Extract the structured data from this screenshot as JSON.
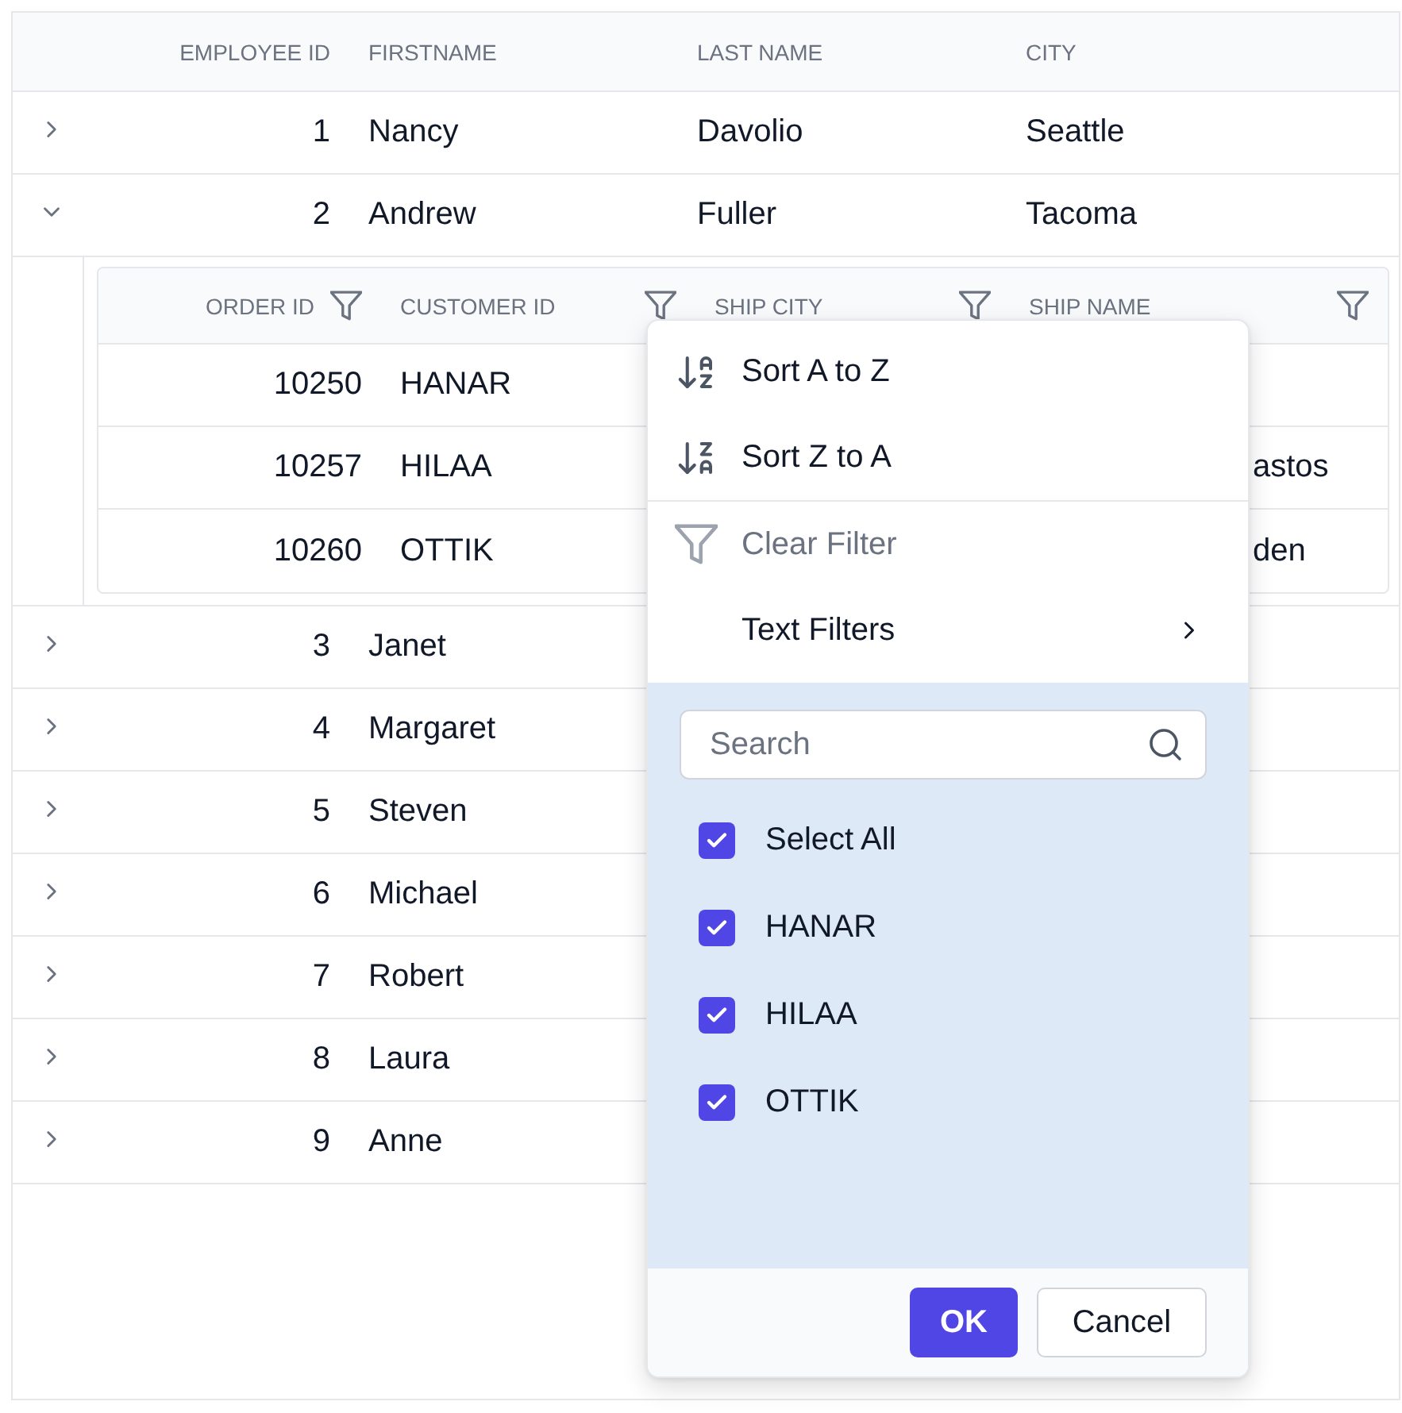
{
  "grid": {
    "columns": [
      {
        "label": "EMPLOYEE ID",
        "kind": "number"
      },
      {
        "label": "FIRSTNAME",
        "kind": "text"
      },
      {
        "label": "LAST NAME",
        "kind": "text"
      },
      {
        "label": "CITY",
        "kind": "text"
      }
    ],
    "rows": [
      {
        "expanded": false,
        "cells": [
          "1",
          "Nancy",
          "Davolio",
          "Seattle"
        ]
      },
      {
        "expanded": true,
        "cells": [
          "2",
          "Andrew",
          "Fuller",
          "Tacoma"
        ],
        "detail": {
          "columns": [
            {
              "label": "ORDER ID",
              "kind": "number"
            },
            {
              "label": "CUSTOMER ID",
              "kind": "text"
            },
            {
              "label": "SHIP CITY",
              "kind": "text"
            },
            {
              "label": "SHIP NAME",
              "kind": "text"
            }
          ],
          "rows": [
            {
              "order_id": "10250",
              "customer_id": "HANAR"
            },
            {
              "order_id": "10257",
              "customer_id": "HILAA",
              "ship_name": "astos"
            },
            {
              "order_id": "10260",
              "customer_id": "OTTIK",
              "ship_name": "den"
            }
          ]
        }
      },
      {
        "expanded": false,
        "cells": [
          "3",
          "Janet"
        ]
      },
      {
        "expanded": false,
        "cells": [
          "4",
          "Margaret"
        ]
      },
      {
        "expanded": false,
        "cells": [
          "5",
          "Steven"
        ]
      },
      {
        "expanded": false,
        "cells": [
          "6",
          "Michael"
        ]
      },
      {
        "expanded": false,
        "cells": [
          "7",
          "Robert"
        ]
      },
      {
        "expanded": false,
        "cells": [
          "8",
          "Laura"
        ]
      },
      {
        "expanded": false,
        "cells": [
          "9",
          "Anne"
        ]
      }
    ]
  },
  "filter_menu": {
    "groups": [
      [
        {
          "kind": "sort_asc",
          "label": "Sort A to Z",
          "disabled": false
        },
        {
          "kind": "sort_desc",
          "label": "Sort Z to A",
          "disabled": false
        }
      ],
      [
        {
          "kind": "clear_filter",
          "label": "Clear Filter",
          "disabled": true
        },
        {
          "kind": "submenu",
          "label": "Text Filters",
          "disabled": false
        }
      ]
    ],
    "search": {
      "placeholder": "Search"
    },
    "options": [
      {
        "label": "Select All",
        "checked": true
      },
      {
        "label": "HANAR",
        "checked": true
      },
      {
        "label": "HILAA",
        "checked": true
      },
      {
        "label": "OTTIK",
        "checked": true
      }
    ],
    "buttons": [
      {
        "label": "OK",
        "kind": "primary"
      },
      {
        "label": "Cancel",
        "kind": "secondary"
      }
    ]
  }
}
